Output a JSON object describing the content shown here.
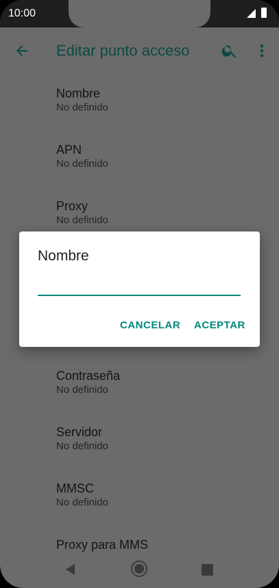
{
  "status": {
    "time": "10:00"
  },
  "appbar": {
    "title": "Editar punto acceso"
  },
  "list": [
    {
      "title": "Nombre",
      "value": "No definido"
    },
    {
      "title": "APN",
      "value": "No definido"
    },
    {
      "title": "Proxy",
      "value": "No definido"
    },
    {
      "title": "Contraseña",
      "value": "No definido"
    },
    {
      "title": "Servidor",
      "value": "No definido"
    },
    {
      "title": "MMSC",
      "value": "No definido"
    },
    {
      "title": "Proxy para MMS",
      "value": ""
    }
  ],
  "dialog": {
    "title": "Nombre",
    "input_value": "",
    "cancel": "CANCELAR",
    "accept": "ACEPTAR"
  },
  "colors": {
    "accent": "#00897b",
    "title": "#0c4a44",
    "scrim_bg": "#6b6b6b"
  },
  "icons": {
    "back": "arrow-left-icon",
    "search": "search-icon",
    "more": "more-vert-icon"
  }
}
